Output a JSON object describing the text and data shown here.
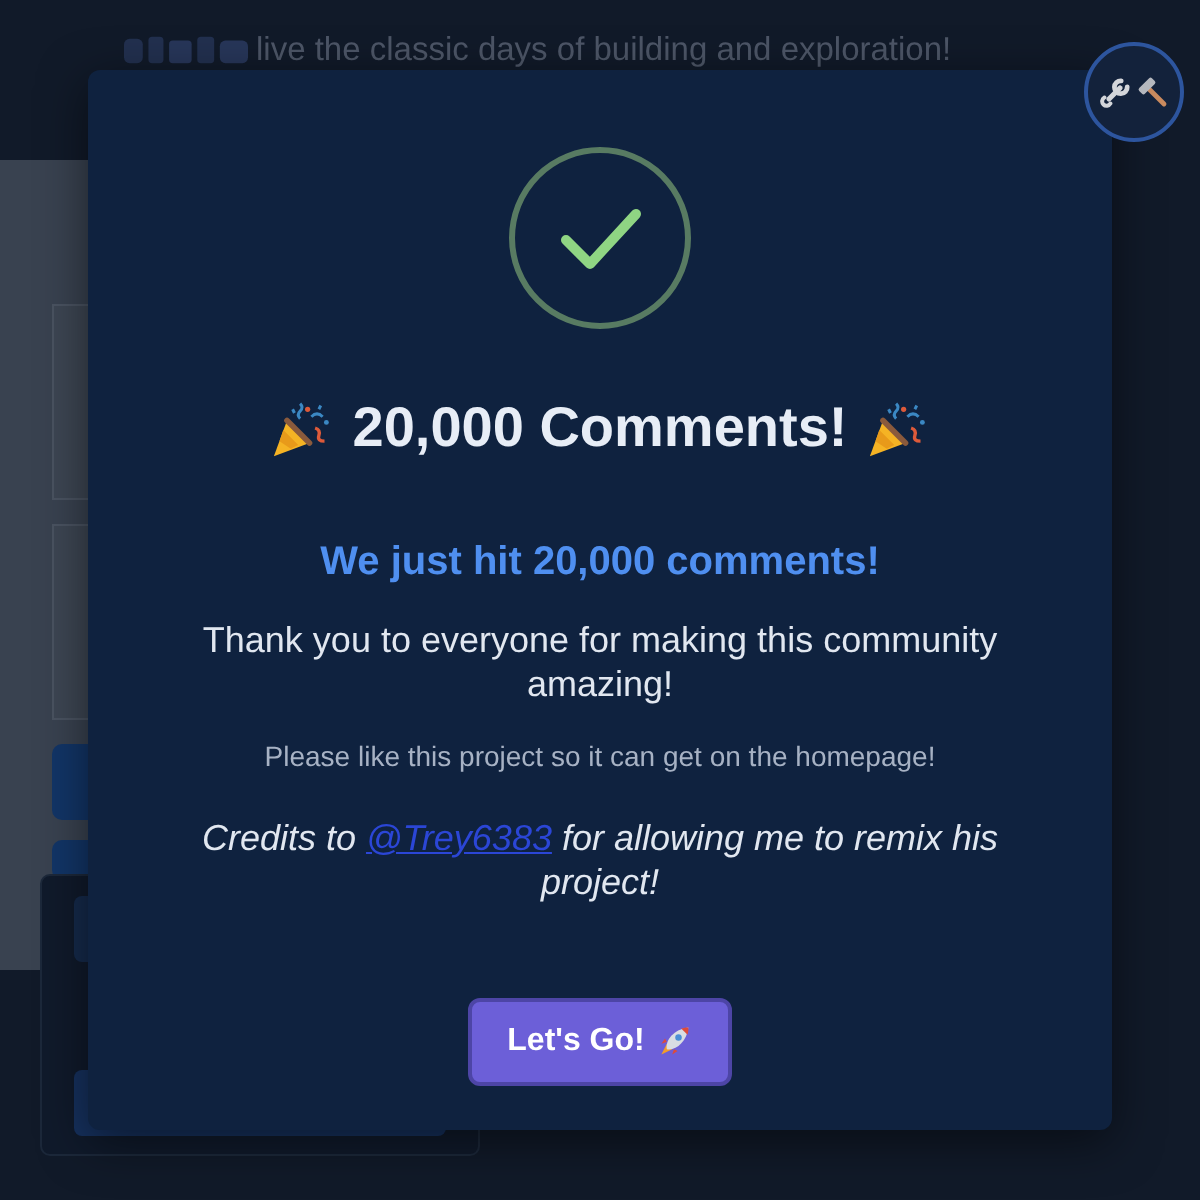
{
  "background": {
    "tagline": "live the classic days of building and exploration!"
  },
  "modal": {
    "title": "20,000 Comments!",
    "headline": "We just hit 20,000 comments!",
    "message": "Thank you to everyone for making this community amazing!",
    "note": "Please like this project so it can get on the homepage!",
    "credits": {
      "before": "Credits to ",
      "link": "@Trey6383",
      "after": " for allowing me to remix his project!"
    },
    "button": "Let's Go!"
  }
}
